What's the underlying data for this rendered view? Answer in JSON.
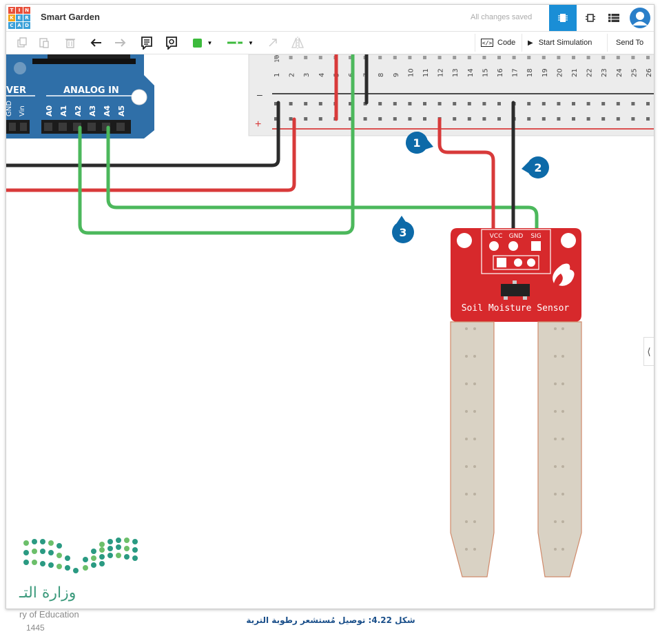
{
  "app": {
    "logo_letters": [
      "T",
      "I",
      "N",
      "K",
      "E",
      "R",
      "C",
      "A",
      "D"
    ],
    "title": "Smart Garden",
    "save_status": "All changes saved"
  },
  "toolbar": {
    "code_label": "Code",
    "start_simulation_label": "Start Simulation",
    "send_to_label": "Send To",
    "wire_color": "#3cba3c"
  },
  "arduino": {
    "power_label": "VER",
    "analog_label": "ANALOG IN",
    "power_pins": [
      "GND",
      "Vin"
    ],
    "analog_pins": [
      "A0",
      "A1",
      "A2",
      "A3",
      "A4",
      "A5"
    ]
  },
  "breadboard": {
    "columns": [
      "1",
      "2",
      "3",
      "4",
      "5",
      "6",
      "7",
      "8",
      "9",
      "10",
      "11",
      "12",
      "13",
      "14",
      "15",
      "16",
      "17",
      "18",
      "19",
      "20",
      "21",
      "22",
      "23",
      "24",
      "25",
      "26"
    ],
    "first_col_label": "10",
    "minus_label": "–",
    "plus_label": "+"
  },
  "sensor": {
    "pins": [
      "VCC",
      "GND",
      "SIG"
    ],
    "name": "Soil Moisture Sensor"
  },
  "callouts": [
    "1",
    "2",
    "3"
  ],
  "colors": {
    "accent": "#1a8ed6",
    "callout": "#0d6aa8",
    "wire_red": "#d83a3a",
    "wire_black": "#2b2b2b",
    "wire_green": "#4cb85c",
    "arduino_blue": "#2f6fa8",
    "sensor_red": "#d7292c"
  },
  "ministry": {
    "arabic_text": "وزارة التـ",
    "english_text": "ry of Education",
    "number": "1445"
  },
  "caption": "شكل 4.22: توصيل مُستشعر رطوبة التربة"
}
